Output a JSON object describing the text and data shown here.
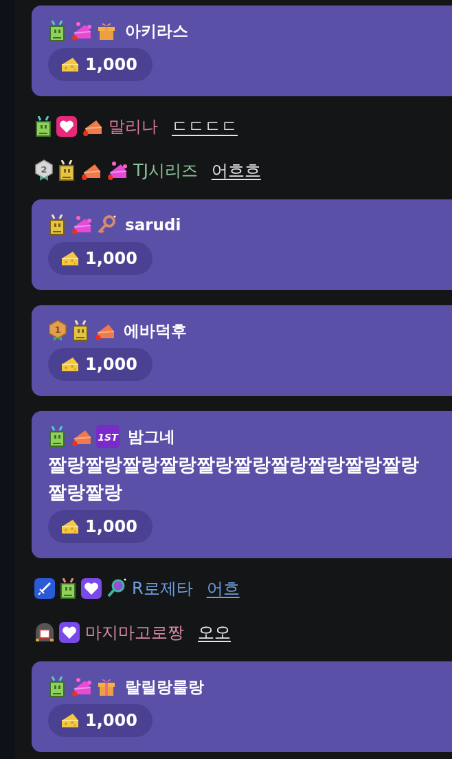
{
  "chat": [
    {
      "kind": "donation",
      "badges": [
        {
          "kind": "robot_green"
        },
        {
          "kind": "pink_cheese"
        },
        {
          "kind": "gift"
        }
      ],
      "nickname": "아키라스",
      "amount": "1,000"
    },
    {
      "kind": "chat",
      "badges": [
        {
          "kind": "robot_green"
        },
        {
          "kind": "heart_pink"
        },
        {
          "kind": "fire_cheese"
        }
      ],
      "nickname": {
        "text": "말리나",
        "color": "#d97a9b"
      },
      "message": {
        "text": "ㄷㄷㄷㄷ",
        "color": "#e6e6e6"
      }
    },
    {
      "kind": "chat",
      "badges": [
        {
          "kind": "medal_silver",
          "label": "2"
        },
        {
          "kind": "robot_gold"
        },
        {
          "kind": "fire_cheese"
        },
        {
          "kind": "pink_cheese"
        }
      ],
      "nickname": {
        "text": "TJ시리즈",
        "color": "#8fc49a"
      },
      "message": {
        "text": "어흐흐",
        "color": "#e6e6e6"
      }
    },
    {
      "kind": "donation",
      "badges": [
        {
          "kind": "robot_gold"
        },
        {
          "kind": "pink_cheese"
        },
        {
          "kind": "key"
        }
      ],
      "nickname": "sarudi",
      "amount": "1,000"
    },
    {
      "kind": "donation",
      "badges": [
        {
          "kind": "medal_gold",
          "label": "1"
        },
        {
          "kind": "robot_gold"
        },
        {
          "kind": "fire_cheese"
        }
      ],
      "nickname": "에바덕후",
      "amount": "1,000"
    },
    {
      "kind": "donation",
      "badges": [
        {
          "kind": "robot_green"
        },
        {
          "kind": "fire_cheese"
        },
        {
          "kind": "first",
          "label": "1ST"
        }
      ],
      "nickname": "밤그네",
      "message": "짤랑짤랑짤랑짤랑짤랑짤랑짤랑짤랑짤랑짤랑짤랑짤랑",
      "amount": "1,000"
    },
    {
      "kind": "chat",
      "badges": [
        {
          "kind": "sword"
        },
        {
          "kind": "robot_pink"
        },
        {
          "kind": "heart_purple"
        },
        {
          "kind": "magnifier"
        }
      ],
      "nickname": {
        "text": "R로제타",
        "color": "#6f9fe0"
      },
      "message": {
        "text": "어흐",
        "color": "#6f9fe0"
      }
    },
    {
      "kind": "chat",
      "badges": [
        {
          "kind": "helmet"
        },
        {
          "kind": "heart_purple"
        }
      ],
      "nickname": {
        "text": "마지마고로짱",
        "color": "#d98aa8"
      },
      "message": {
        "text": "오오",
        "color": "#e6e6e6"
      }
    },
    {
      "kind": "donation",
      "badges": [
        {
          "kind": "robot_green"
        },
        {
          "kind": "pink_cheese"
        },
        {
          "kind": "gift_pink"
        }
      ],
      "nickname": "랄릴랑룰랑",
      "amount": "1,000"
    }
  ]
}
